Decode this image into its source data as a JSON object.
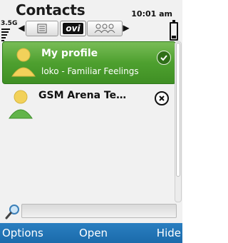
{
  "header": {
    "title": "Contacts",
    "time": "10:01 am"
  },
  "status_bar": {
    "signal_label": "3.5G",
    "battery_icon": "battery-icon"
  },
  "tabs": {
    "items": [
      {
        "name": "contacts-list-tab",
        "icon": "list-icon"
      },
      {
        "name": "ovi-tab",
        "label": "ovi",
        "selected": true
      },
      {
        "name": "groups-tab",
        "icon": "groups-icon"
      }
    ],
    "left_arrow": "◀",
    "right_arrow": "▶"
  },
  "contacts": [
    {
      "name": "My profile",
      "status": "loko - Familiar Feelings",
      "selected": true,
      "status_icon": "check-icon"
    },
    {
      "name": "GSM Arena Te…",
      "status": "",
      "selected": false,
      "status_icon": "x-icon"
    }
  ],
  "search": {
    "placeholder": ""
  },
  "softkeys": {
    "left": "Options",
    "center": "Open",
    "right": "Hide"
  },
  "colors": {
    "accent_green": "#4ea02f",
    "softkey_blue": "#1b6bab"
  }
}
